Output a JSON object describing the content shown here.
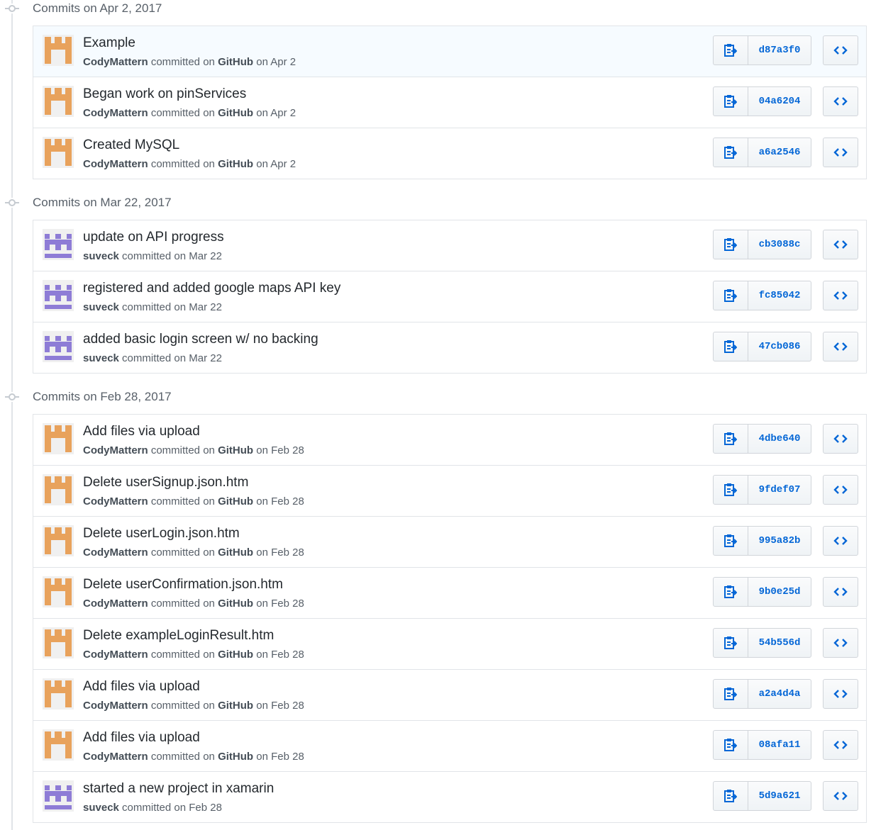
{
  "colors": {
    "link": "#0366d6",
    "muted": "#586069",
    "border": "#e1e4e8",
    "avatar_orange": "#e8a25c",
    "avatar_purple": "#8e7cd6"
  },
  "groups": [
    {
      "header": "Commits on Apr 2, 2017",
      "commits": [
        {
          "title": "Example",
          "author": "CodyMattern",
          "committed": "committed on",
          "via": "GitHub",
          "date": "on Apr 2",
          "sha": "d87a3f0",
          "avatar": "orange-identicon"
        },
        {
          "title": "Began work on pinServices",
          "author": "CodyMattern",
          "committed": "committed on",
          "via": "GitHub",
          "date": "on Apr 2",
          "sha": "04a6204",
          "avatar": "orange-identicon"
        },
        {
          "title": "Created MySQL",
          "author": "CodyMattern",
          "committed": "committed on",
          "via": "GitHub",
          "date": "on Apr 2",
          "sha": "a6a2546",
          "avatar": "orange-identicon"
        }
      ]
    },
    {
      "header": "Commits on Mar 22, 2017",
      "commits": [
        {
          "title": "update on API progress",
          "author": "suveck",
          "committed": "committed",
          "via": "",
          "date": "on Mar 22",
          "sha": "cb3088c",
          "avatar": "purple-identicon"
        },
        {
          "title": "registered and added google maps API key",
          "author": "suveck",
          "committed": "committed",
          "via": "",
          "date": "on Mar 22",
          "sha": "fc85042",
          "avatar": "purple-identicon"
        },
        {
          "title": "added basic login screen w/ no backing",
          "author": "suveck",
          "committed": "committed",
          "via": "",
          "date": "on Mar 22",
          "sha": "47cb086",
          "avatar": "purple-identicon"
        }
      ]
    },
    {
      "header": "Commits on Feb 28, 2017",
      "commits": [
        {
          "title": "Add files via upload",
          "author": "CodyMattern",
          "committed": "committed on",
          "via": "GitHub",
          "date": "on Feb 28",
          "sha": "4dbe640",
          "avatar": "orange-identicon"
        },
        {
          "title": "Delete userSignup.json.htm",
          "author": "CodyMattern",
          "committed": "committed on",
          "via": "GitHub",
          "date": "on Feb 28",
          "sha": "9fdef07",
          "avatar": "orange-identicon"
        },
        {
          "title": "Delete userLogin.json.htm",
          "author": "CodyMattern",
          "committed": "committed on",
          "via": "GitHub",
          "date": "on Feb 28",
          "sha": "995a82b",
          "avatar": "orange-identicon"
        },
        {
          "title": "Delete userConfirmation.json.htm",
          "author": "CodyMattern",
          "committed": "committed on",
          "via": "GitHub",
          "date": "on Feb 28",
          "sha": "9b0e25d",
          "avatar": "orange-identicon"
        },
        {
          "title": "Delete exampleLoginResult.htm",
          "author": "CodyMattern",
          "committed": "committed on",
          "via": "GitHub",
          "date": "on Feb 28",
          "sha": "54b556d",
          "avatar": "orange-identicon"
        },
        {
          "title": "Add files via upload",
          "author": "CodyMattern",
          "committed": "committed on",
          "via": "GitHub",
          "date": "on Feb 28",
          "sha": "a2a4d4a",
          "avatar": "orange-identicon"
        },
        {
          "title": "Add files via upload",
          "author": "CodyMattern",
          "committed": "committed on",
          "via": "GitHub",
          "date": "on Feb 28",
          "sha": "08afa11",
          "avatar": "orange-identicon"
        },
        {
          "title": "started a new project in xamarin",
          "author": "suveck",
          "committed": "committed",
          "via": "",
          "date": "on Feb 28",
          "sha": "5d9a621",
          "avatar": "purple-identicon"
        }
      ]
    }
  ]
}
